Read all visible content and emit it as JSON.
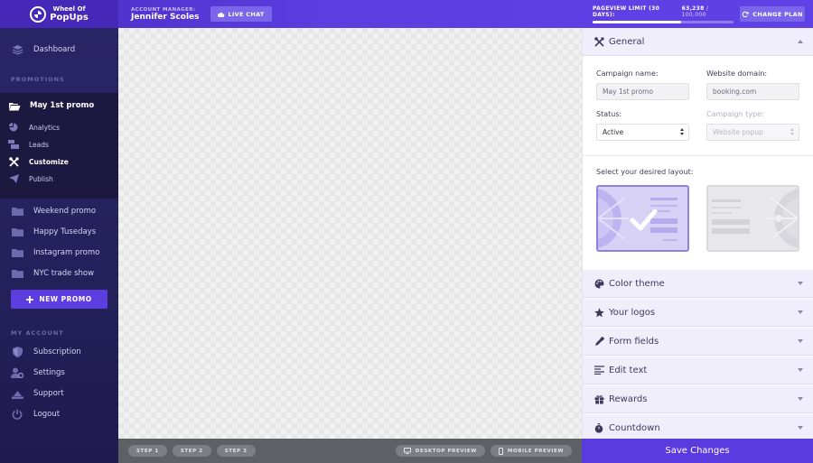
{
  "brand": {
    "line1": "Wheel Of",
    "line2": "PopUps"
  },
  "header": {
    "account_manager_label": "ACCOUNT MANAGER:",
    "account_manager_name": "Jennifer Scoles",
    "live_chat": "LIVE CHAT",
    "pageview_label": "PAGEVIEW LIMIT (30 DAYS):",
    "pageview_used": "63,238",
    "pageview_limit": "/ 100,000",
    "pageview_fraction": 0.63,
    "change_plan": "CHANGE PLAN"
  },
  "sidebar": {
    "dashboard": "Dashboard",
    "promotions_label": "PROMOTIONS",
    "active_promo": "May 1st promo",
    "sub_items": [
      "Analytics",
      "Leads",
      "Customize",
      "Publish"
    ],
    "active_sub": "Customize",
    "promos": [
      "Weekend promo",
      "Happy Tusedays",
      "Instagram promo",
      "NYC trade show"
    ],
    "new_promo": "NEW PROMO",
    "account_label": "MY ACCOUNT",
    "account_items": [
      "Subscription",
      "Settings",
      "Support",
      "Logout"
    ]
  },
  "bottom": {
    "steps": [
      "STEP 1",
      "STEP 2",
      "STEP 3"
    ],
    "desktop_preview": "DESKTOP PREVIEW",
    "mobile_preview": "MOBILE PREVIEW"
  },
  "panel": {
    "general": "General",
    "campaign_name_label": "Campaign name:",
    "campaign_name_value": "May 1st promo",
    "website_domain_label": "Website domain:",
    "website_domain_value": "booking.com",
    "status_label": "Status:",
    "status_value": "Active",
    "campaign_type_label": "Campaign type:",
    "campaign_type_value": "Website popup",
    "layout_label": "Select your desired layout:",
    "sections": [
      "Color theme",
      "Your logos",
      "Form fields",
      "Edit text",
      "Rewards",
      "Countdown"
    ]
  },
  "save_changes": "Save Changes",
  "colors": {
    "accent": "#5a3be0",
    "sidebar": "#24205a"
  }
}
